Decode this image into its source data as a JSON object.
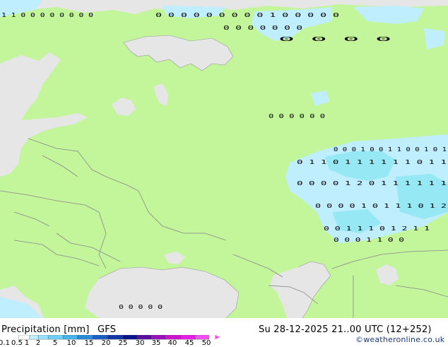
{
  "title": {
    "variable": "Precipitation [mm]",
    "model": "GFS",
    "valid_time": "Su 28-12-2025 21..00 UTC (12+252)",
    "credit": "©weatheronline.co.uk"
  },
  "legend": {
    "ticks": [
      "0.1",
      "0.5",
      "1",
      "2",
      "5",
      "10",
      "15",
      "20",
      "25",
      "30",
      "35",
      "40",
      "45",
      "50"
    ],
    "colors": [
      "#ffffff",
      "#bfeeff",
      "#96e0ff",
      "#6ecff5",
      "#46b4e8",
      "#2a8ad6",
      "#1c5ec4",
      "#1236a8",
      "#0a148a",
      "#5a0ca0",
      "#9a10bc",
      "#cc14cc",
      "#e61ee6",
      "#f050f0"
    ]
  },
  "map_colors": {
    "land": "#c3f59a",
    "sea": "#e6e6e6",
    "border": "#888888",
    "coast": "#999999",
    "precip_light": "#bfeeff",
    "precip_mid": "#96e8f5"
  },
  "symbol_rows": [
    {
      "vals": "1 1 0 0 0 0 0 0 0 0"
    },
    {
      "vals": "0 0 0 0 0 0 0 0 0 1 0 0 0 0 0"
    },
    {
      "vals": "0 0 0 0 0 0 0"
    },
    {
      "vals": "0 0 0 0"
    },
    {
      "vals": "0 0 0 0 0 0"
    },
    {
      "vals": "0 0 0 1 0 0 1 1 0 0 1 0 1"
    },
    {
      "vals": "0 1 1 0 1 1 1 1 1 1 0 1 1"
    },
    {
      "vals": "0 0 0 0 1 2 0 1 1 1 1 1 1"
    },
    {
      "vals": "0 0 0 0 1 0 1 1 1 0 1 2"
    },
    {
      "vals": "0 0 1 1 1 0 1 2 1 1"
    },
    {
      "vals": "0 0 0 1 1 0 0"
    },
    {
      "vals": "0 0 0 0 0"
    }
  ]
}
